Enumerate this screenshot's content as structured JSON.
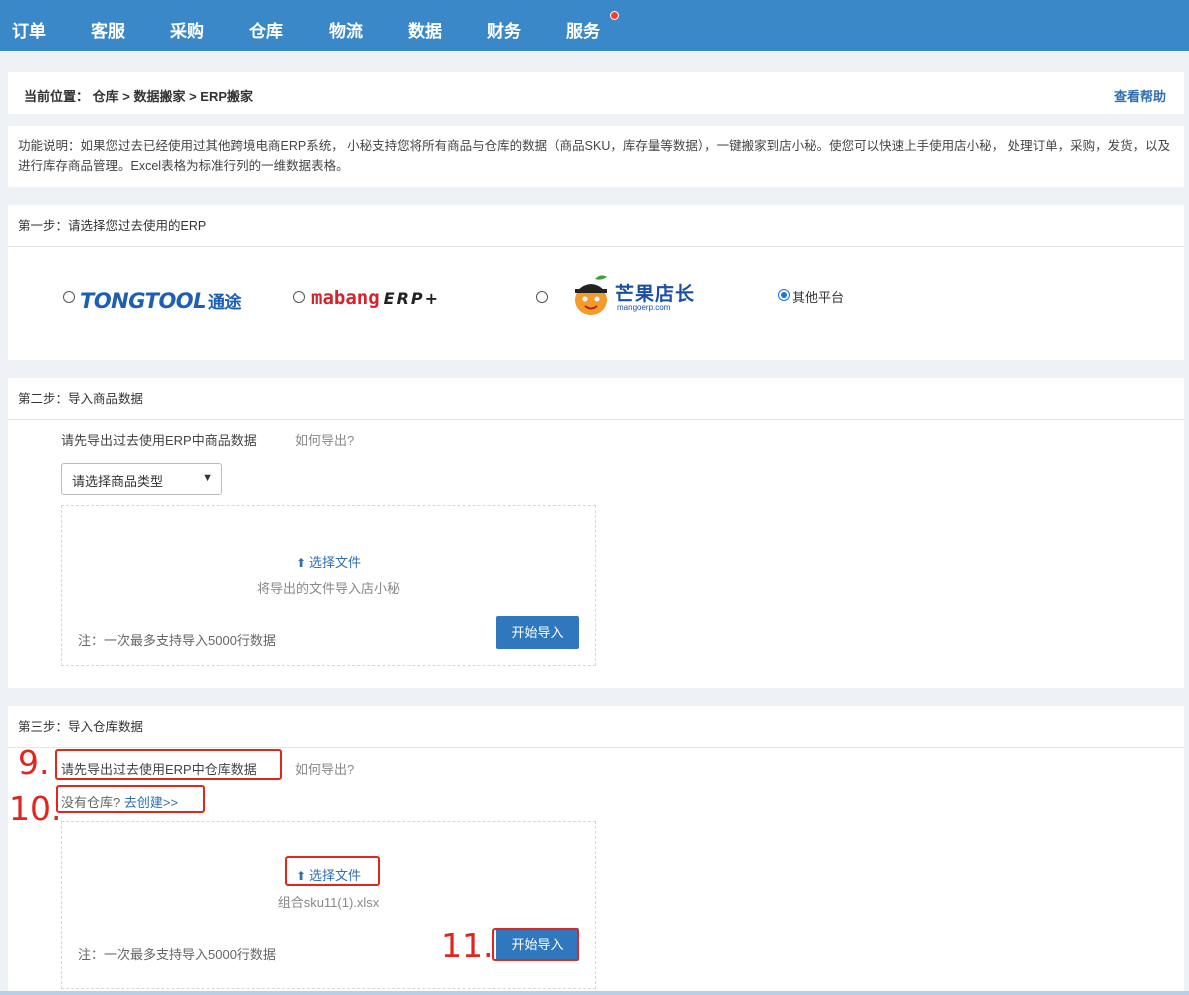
{
  "nav": {
    "items": [
      "订单",
      "客服",
      "采购",
      "仓库",
      "物流",
      "数据",
      "财务",
      "服务"
    ]
  },
  "breadcrumb": {
    "label": "当前位置：",
    "path": "仓库 > 数据搬家 > ERP搬家",
    "help": "查看帮助"
  },
  "description": "功能说明：如果您过去已经使用过其他跨境电商ERP系统， 小秘支持您将所有商品与仓库的数据（商品SKU，库存量等数据），一键搬家到店小秘。使您可以快速上手使用店小秘， 处理订单，采购，发货，以及进行库存商品管理。Excel表格为标准行列的一维数据表格。",
  "step1": {
    "title": "第一步：请选择您过去使用的ERP",
    "options": [
      {
        "logo_text": "TONGTOOL",
        "logo_cn": "通途",
        "checked": false
      },
      {
        "logo_text": "mabang",
        "logo_suffix": "ERP+",
        "checked": false
      },
      {
        "logo_cn": "芒果店长",
        "logo_en": "mangoerp.com",
        "checked": false
      },
      {
        "label": "其他平台",
        "checked": true
      }
    ]
  },
  "step2": {
    "title": "第二步：导入商品数据",
    "hint": "请先导出过去使用ERP中商品数据",
    "howto": "如何导出?",
    "select_value": "请选择商品类型",
    "choose_file": "选择文件",
    "sub": "将导出的文件导入店小秘",
    "note": "注：一次最多支持导入5000行数据",
    "button": "开始导入"
  },
  "step3": {
    "title": "第三步：导入仓库数据",
    "hint": "请先导出过去使用ERP中仓库数据",
    "howto": "如何导出?",
    "no_warehouse": "没有仓库?",
    "create_link": "去创建>>",
    "choose_file": "选择文件",
    "file_name": "组合sku11(1).xlsx",
    "note": "注：一次最多支持导入5000行数据",
    "button": "开始导入"
  },
  "annotations": [
    "9.",
    "10.",
    "11."
  ]
}
